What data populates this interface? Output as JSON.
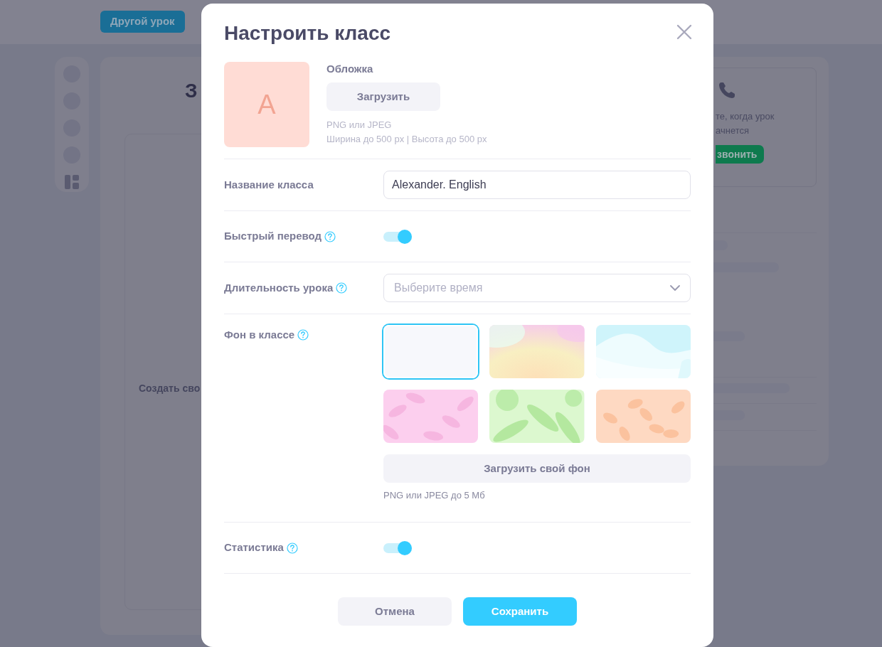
{
  "background_page": {
    "top_button": "Другой урок",
    "heading_fragment": "З",
    "create_fragment": "Создать сво",
    "call_card": {
      "text_lines": [
        "те, когда урок",
        "ачнется"
      ],
      "button": "звонить"
    }
  },
  "modal": {
    "title": "Настроить класс",
    "cover": {
      "letter": "A",
      "label": "Обложка",
      "upload_button": "Загрузить",
      "hints": [
        "PNG или JPEG",
        "Ширина до 500 px | Высота до 500 px"
      ]
    },
    "fields": [
      {
        "kind": "text",
        "label": "Название класса",
        "help": false,
        "value": "Alexander. English"
      },
      {
        "kind": "toggle",
        "label": "Быстрый перевод",
        "help": true,
        "on": true
      },
      {
        "kind": "select",
        "label": "Длительность урока",
        "help": true,
        "placeholder": "Выберите время"
      },
      {
        "kind": "backgrounds",
        "label": "Фон в классе",
        "help": true,
        "options": [
          {
            "kind": "plain",
            "selected": true
          },
          {
            "kind": "gradient",
            "selected": false
          },
          {
            "kind": "waves",
            "selected": false
          },
          {
            "kind": "pink-leaves",
            "selected": false
          },
          {
            "kind": "tropical",
            "selected": false
          },
          {
            "kind": "autumn",
            "selected": false
          }
        ],
        "upload_button": "Загрузить свой фон",
        "hint": "PNG или JPEG до 5 Мб"
      },
      {
        "kind": "toggle",
        "label": "Статистика",
        "help": true,
        "on": true
      }
    ],
    "buttons": [
      {
        "kind": "secondary",
        "label": "Отмена"
      },
      {
        "kind": "primary",
        "label": "Сохранить"
      }
    ]
  }
}
